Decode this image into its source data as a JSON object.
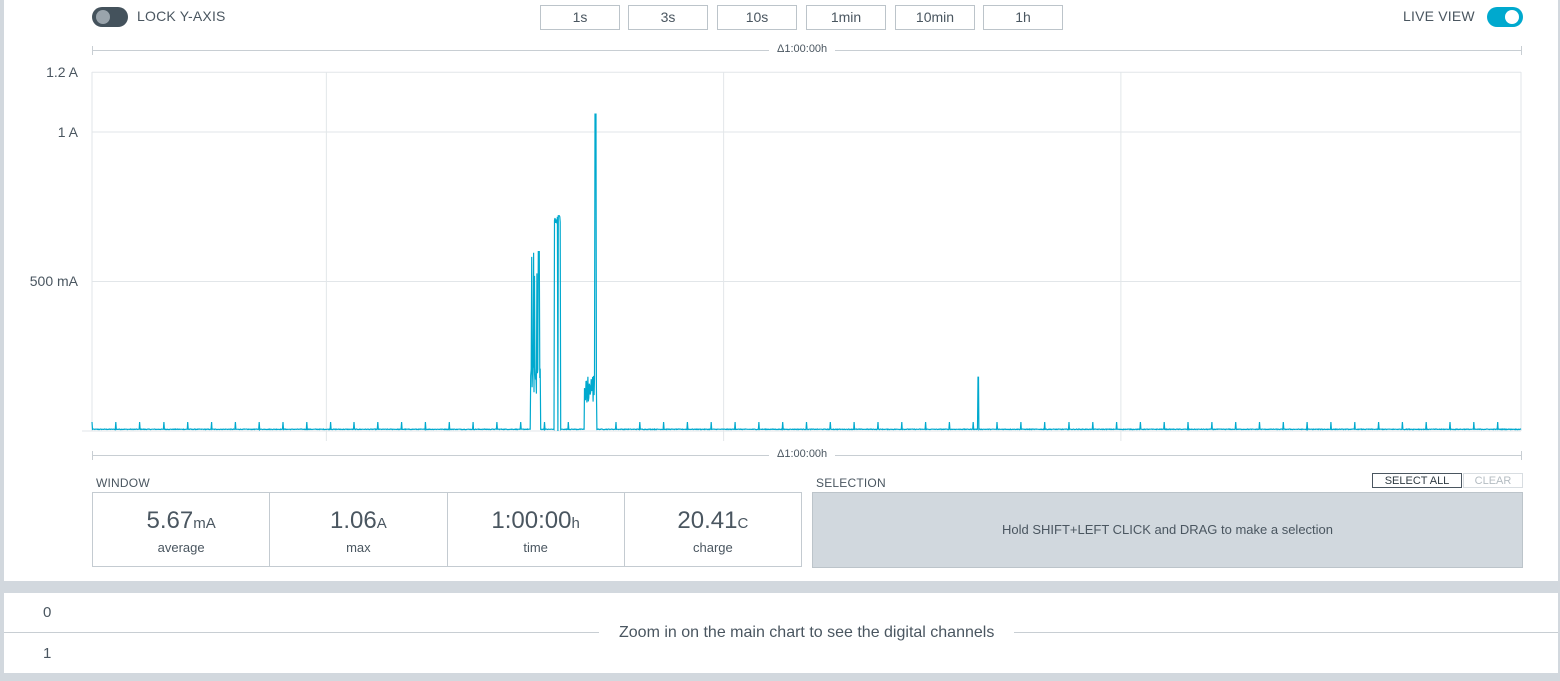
{
  "controls": {
    "lock_y_axis_label": "LOCK Y-AXIS",
    "lock_y_axis_on": false,
    "live_view_label": "LIVE VIEW",
    "live_view_on": true,
    "zoom_buttons": [
      "1s",
      "3s",
      "10s",
      "1min",
      "10min",
      "1h"
    ]
  },
  "timeline": {
    "top_label": "Δ1:00:00h",
    "bottom_label": "Δ1:00:00h"
  },
  "chart_data": {
    "type": "line",
    "y_ticks": [
      {
        "value": 1.2,
        "label": "1.2 A"
      },
      {
        "value": 1.0,
        "label": "1 A"
      },
      {
        "value": 0.5,
        "label": "500 mA"
      }
    ],
    "ylim": [
      0,
      1.2
    ],
    "x_range_seconds": [
      0,
      3600
    ],
    "baseline_current_A": 0.0057,
    "periodic_spike_interval_s": 60,
    "periodic_spike_height_A": 0.03,
    "bursts": [
      {
        "t_start": 1105,
        "t_end": 1130,
        "level_A": 0.2,
        "peak_A": 0.6
      },
      {
        "t_start": 1165,
        "t_end": 1180,
        "level_A": 0.0,
        "peak_A": 0.72
      },
      {
        "t_start": 1240,
        "t_end": 1272,
        "level_A": 0.15,
        "peak_A": 1.06
      }
    ],
    "single_spikes": [
      {
        "t": 2233,
        "peak_A": 0.18
      }
    ],
    "series_color": "#00a9ce",
    "grid": true
  },
  "window": {
    "title": "WINDOW",
    "stats": [
      {
        "value": "5.67",
        "unit": "mA",
        "caption": "average"
      },
      {
        "value": "1.06",
        "unit": "A",
        "caption": "max"
      },
      {
        "value": "1:00:00",
        "unit": "h",
        "caption": "time"
      },
      {
        "value": "20.41",
        "unit": "C",
        "caption": "charge"
      }
    ]
  },
  "selection": {
    "title": "SELECTION",
    "select_all_label": "SELECT ALL",
    "clear_label": "CLEAR",
    "hint": "Hold SHIFT+LEFT CLICK and DRAG to make a selection"
  },
  "digital": {
    "channels": [
      "0",
      "1"
    ],
    "message": "Zoom in on the main chart to see the digital channels"
  },
  "colors": {
    "accent": "#00a9ce",
    "toggle_off": "#44525c",
    "text": "#4a5660",
    "background": "#d2d8de"
  }
}
